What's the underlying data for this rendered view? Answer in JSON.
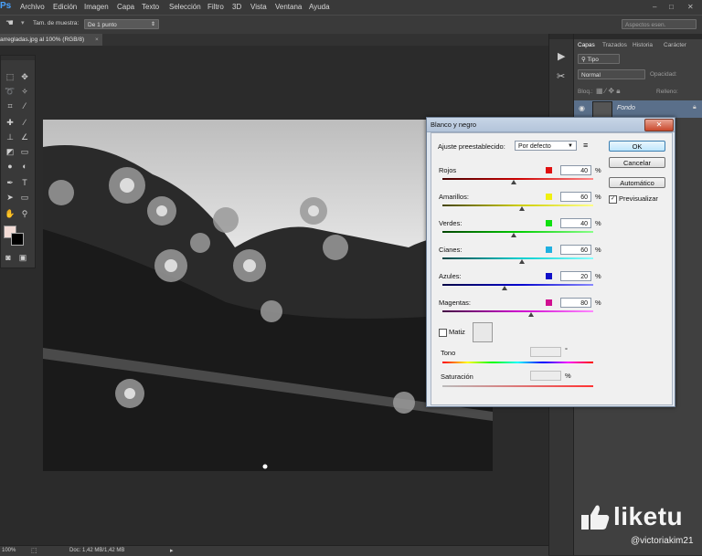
{
  "menubar": {
    "logo": "Ps",
    "items": [
      "Archivo",
      "Edición",
      "Imagen",
      "Capa",
      "Texto",
      "Selección",
      "Filtro",
      "3D",
      "Vista",
      "Ventana",
      "Ayuda"
    ],
    "window_buttons": [
      "–",
      "□",
      "✕"
    ]
  },
  "options": {
    "sample_size_label": "Tam. de muestra:",
    "sample_size_value": "De 1 punto",
    "workspace_value": "Aspectos esen."
  },
  "document": {
    "tab_title": "arregladas.jpg al 100% (RGB/8)",
    "tab_close": "×"
  },
  "status": {
    "zoom": "100%",
    "doc_info": "Doc: 1,42 MB/1,42 MB"
  },
  "panels": {
    "tabs": [
      "Capas",
      "Trazados",
      "Historia",
      "Carácter"
    ],
    "kind_select": "Tipo",
    "blend_mode": "Normal",
    "opacity_label": "Opacidad:",
    "lock_label": "Bloq.:",
    "fill_label": "Relleno:",
    "layer_name": "Fondo"
  },
  "dialog": {
    "title": "Blanco y negro",
    "preset_label": "Ajuste preestablecido:",
    "preset_value": "Por defecto",
    "sliders": [
      {
        "label": "Rojos",
        "value": "40",
        "swatch": "#e01010",
        "thumb_fraction": 0.47
      },
      {
        "label": "Amarillos:",
        "value": "60",
        "swatch": "#f0f010",
        "thumb_fraction": 0.53
      },
      {
        "label": "Verdes:",
        "value": "40",
        "swatch": "#10e010",
        "thumb_fraction": 0.47
      },
      {
        "label": "Cianes:",
        "value": "60",
        "swatch": "#20b0e0",
        "thumb_fraction": 0.53
      },
      {
        "label": "Azules:",
        "value": "20",
        "swatch": "#1010c8",
        "thumb_fraction": 0.41
      },
      {
        "label": "Magentas:",
        "value": "80",
        "swatch": "#d01090",
        "thumb_fraction": 0.59
      }
    ],
    "percent": "%",
    "tint_label": "Matiz",
    "hue_label": "Tono",
    "hue_unit": "°",
    "saturation_label": "Saturación",
    "saturation_unit": "%",
    "buttons": {
      "ok": "OK",
      "cancel": "Cancelar",
      "auto": "Automático"
    },
    "preview_label": "Previsualizar"
  },
  "watermark": {
    "brand": "liketu",
    "user": "@victoriakim21"
  }
}
